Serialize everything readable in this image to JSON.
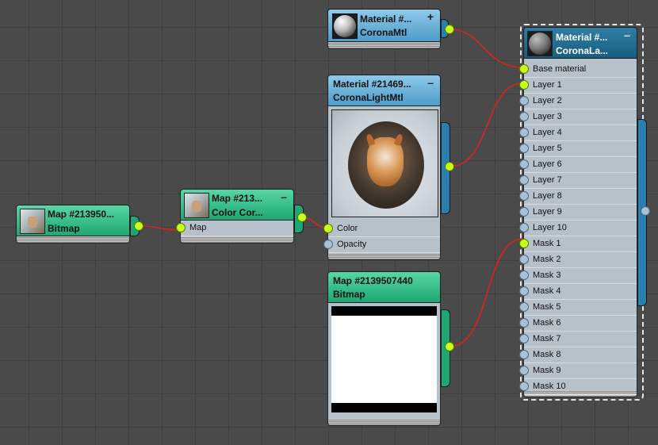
{
  "nodes": {
    "material_corona": {
      "title": "Material  #...",
      "subtitle": "CoronaMtl",
      "toggle": "+"
    },
    "material_light": {
      "title": "Material  #21469...",
      "subtitle": "CoronaLightMtl",
      "toggle": "–",
      "slots": [
        "Color",
        "Opacity"
      ]
    },
    "bitmap_left": {
      "title": "Map  #213950...",
      "subtitle": "Bitmap"
    },
    "color_correct": {
      "title": "Map  #213...",
      "subtitle": "Color  Cor...",
      "toggle": "–",
      "slots": [
        "Map"
      ]
    },
    "bitmap_mask": {
      "title": "Map #2139507440",
      "subtitle": "Bitmap"
    },
    "corona_layered": {
      "title": "Material  #...",
      "subtitle": "CoronaLa...",
      "toggle": "–",
      "slots": [
        "Base material",
        "Layer 1",
        "Layer 2",
        "Layer 3",
        "Layer 4",
        "Layer 5",
        "Layer 6",
        "Layer 7",
        "Layer 8",
        "Layer 9",
        "Layer 10",
        "Mask 1",
        "Mask 2",
        "Mask 3",
        "Mask 4",
        "Mask 5",
        "Mask 6",
        "Mask 7",
        "Mask 8",
        "Mask 9",
        "Mask 10"
      ],
      "connected": [
        "Base material",
        "Layer 1",
        "Mask 1"
      ]
    }
  },
  "colors": {
    "canvas": "#4a4a4a",
    "wire": "#e02020",
    "socket_connected": "#c9ff1e",
    "socket_empty": "#a8c1d6",
    "header_material": "#4d9cc8",
    "header_map": "#1ea774"
  },
  "icons": [
    "sphere-preview-icon",
    "dog-photo-thumbnail",
    "bitmap-thumbnail-icon",
    "mask-preview-icon"
  ]
}
